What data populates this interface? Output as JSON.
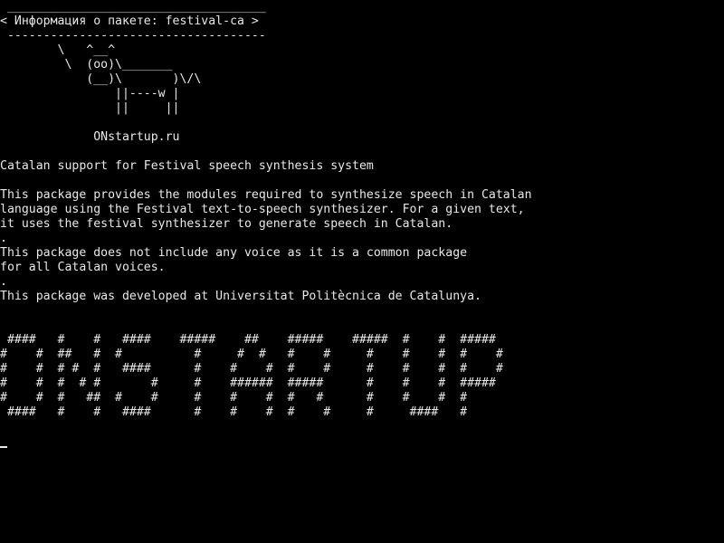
{
  "colors": {
    "background": "#000000",
    "foreground": "#e8e8e8"
  },
  "screen": {
    "lines": [
      " ____________________________________",
      "< Информация о пакете: festival-ca >",
      " ------------------------------------",
      "        \\   ^__^",
      "         \\  (oo)\\_______",
      "            (__)\\       )\\/\\",
      "                ||----w |",
      "                ||     ||",
      "",
      "             ONstartup.ru",
      "",
      "Catalan support for Festival speech synthesis system",
      "",
      "This package provides the modules required to synthesize speech in Catalan",
      "language using the Festival text-to-speech synthesizer. For a given text,",
      "it uses the festival synthesizer to generate speech in Catalan.",
      ".",
      "This package does not include any voice as it is a common package",
      "for all Catalan voices.",
      ".",
      "This package was developed at Universitat Politècnica de Catalunya.",
      "",
      "",
      " ####   #    #   ####    #####    ##    #####    #####  #    #  #####",
      "#    #  ##   #  #          #     #  #   #    #     #    #    #  #    #",
      "#    #  # #  #   ####      #    #    #  #    #     #    #    #  #    #",
      "#    #  #  # #       #     #    ######  #####      #    #    #  #####",
      "#    #  #   ##  #    #     #    #    #  #   #      #    #    #  #",
      " ####   #    #   ####      #    #    #  #    #     #     ####   #",
      ""
    ]
  }
}
